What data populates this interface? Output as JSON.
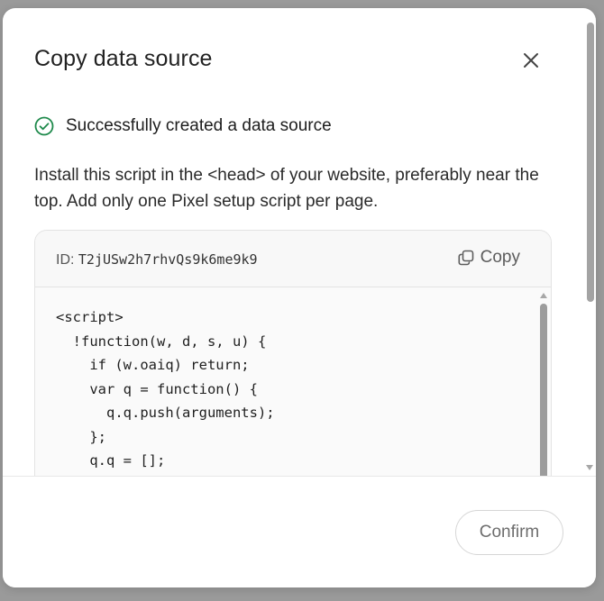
{
  "dialog": {
    "title": "Copy data source",
    "close_icon": "close-icon"
  },
  "success": {
    "icon": "check-circle-icon",
    "color": "#1f8a4c",
    "message": "Successfully created a data source"
  },
  "instructions": "Install this script in the <head> of your website, preferably near the top. Add only one Pixel setup script per page.",
  "code_block": {
    "id_label": "ID:",
    "id_value": "T2jUSw2h7rhvQs9k6me9k9",
    "copy_label": "Copy",
    "copy_icon": "copy-icon",
    "code": "<script>\n  !function(w, d, s, u) {\n    if (w.oaiq) return;\n    var q = function() {\n      q.q.push(arguments);\n    };\n    q.q = [];\n    w.oaiq = q;"
  },
  "footer": {
    "confirm_label": "Confirm"
  }
}
